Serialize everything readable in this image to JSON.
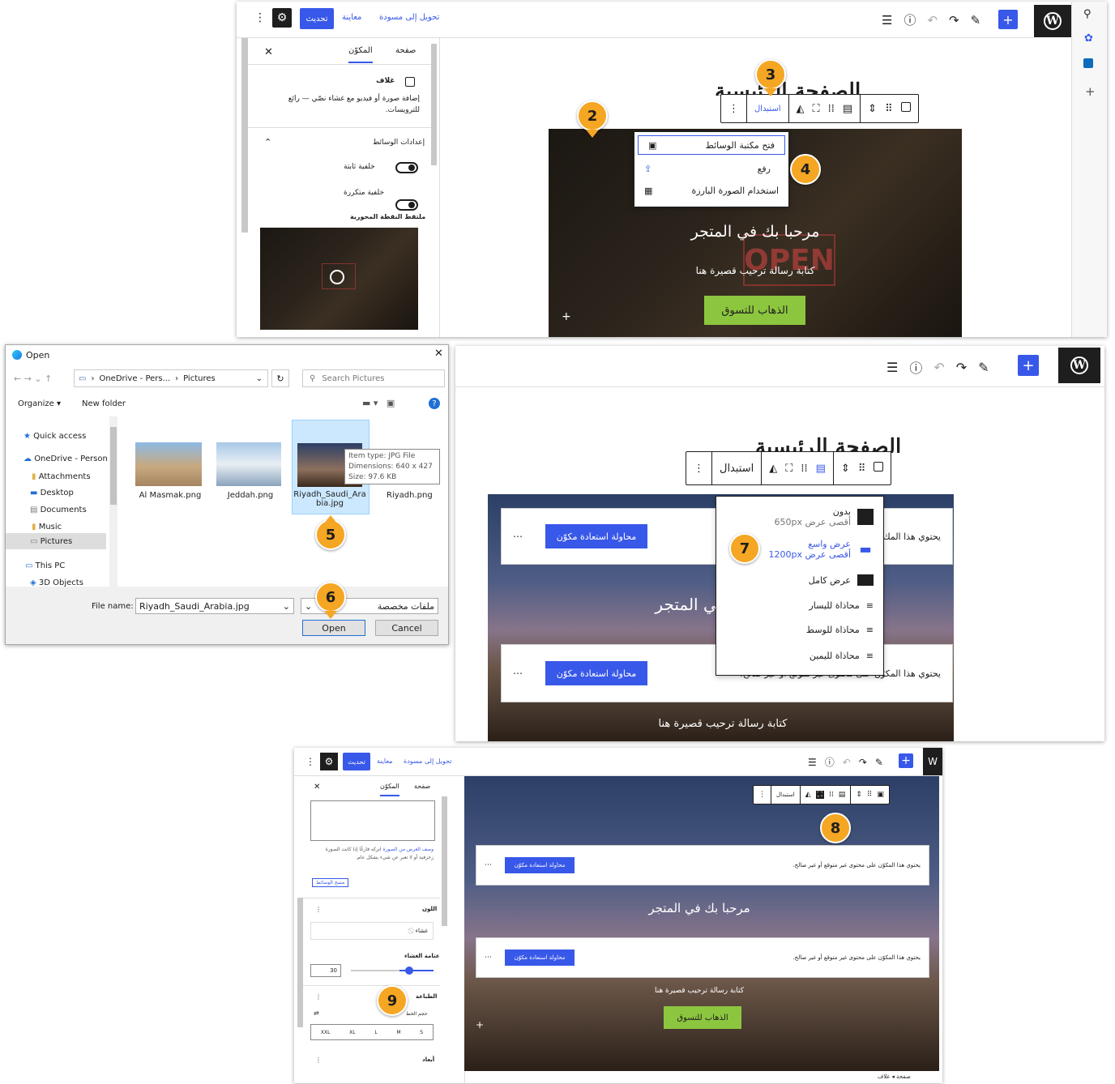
{
  "editor1": {
    "topbar": {
      "convert_draft": "تحويل إلى مسودة",
      "preview": "معاينة",
      "update": "تحديث"
    },
    "side_icons": [
      "search-icon",
      "settings-icon",
      "outlook-icon",
      "plus-icon"
    ],
    "sidebar": {
      "tab_page": "صفحة",
      "tab_block": "المكوّن",
      "block_name": "غلاف",
      "block_desc": "إضافة صورة أو فيديو مع غشاء نصّي — رائع للترويسات.",
      "media_settings": "إعدادات الوسائط",
      "fixed_bg": "خلفية ثابتة",
      "repeat_bg": "خلفية متكررة",
      "focal_point": "ملتقط النقطة المحورية"
    },
    "toolbar": {
      "replace": "استبدال"
    },
    "replace_menu": {
      "open_library": "فتح مكتبة الوسائط",
      "upload": "رفع",
      "use_featured": "استخدام الصورة البارزة"
    },
    "hero": {
      "title": "مرحبا بك في المتجر",
      "subtitle": "كتابة رسالة ترحيب قصيرة هنا",
      "button": "الذهاب للتسوق"
    },
    "page_title": "الصفحة الرئيسية"
  },
  "dialog": {
    "title": "Open",
    "path": [
      "OneDrive - Pers...",
      "Pictures"
    ],
    "search_placeholder": "Search Pictures",
    "organize": "Organize ▾",
    "new_folder": "New folder",
    "sidebar": [
      "Quick access",
      "OneDrive - Person",
      "Attachments",
      "Desktop",
      "Documents",
      "Music",
      "Pictures",
      "This PC",
      "3D Objects"
    ],
    "files": [
      "Al Masmak.png",
      "Jeddah.png",
      "Riyadh_Saudi_Arabia.jpg",
      "Riyadh.png"
    ],
    "tooltip": [
      "Item type: JPG File",
      "Dimensions: 640 x 427",
      "Size: 97.6 KB"
    ],
    "file_name_label": "File name:",
    "file_name_value": "Riyadh_Saudi_Arabia.jpg",
    "file_type": "ملفات مخصصة",
    "open": "Open",
    "cancel": "Cancel"
  },
  "editor2": {
    "toolbar": {
      "replace": "استبدال"
    },
    "notice_text": "يحتوي هذا المكوّن على محتوى غير متوقع أو غير صالح.",
    "notice_text_short": "يحتوي هذا المك",
    "recover": "محاولة استعادة مكوّن",
    "hero_title": "مرحبا بك في المتجر",
    "hero_sub": "كتابة رسالة ترحيب قصيرة هنا",
    "align_menu": [
      {
        "label": "بدون",
        "sub": "أقصى عرض 650px"
      },
      {
        "label": "عرض واسع",
        "sub": "أقصى عرض 1200px"
      },
      {
        "label": "عرض كامل",
        "sub": ""
      },
      {
        "label": "محاذاة لليسار",
        "sub": ""
      },
      {
        "label": "محاذاة للوسط",
        "sub": ""
      },
      {
        "label": "محاذاة لليمين",
        "sub": ""
      }
    ]
  },
  "editor3": {
    "topbar": {
      "convert_draft": "تحويل إلى مسودة",
      "preview": "معاينة",
      "update": "تحديث"
    },
    "tab_page": "صفحة",
    "tab_block": "المكوّن",
    "alt_help_link": "وصف الغرض من الصورة",
    "alt_help": "اتركه فارغًا إذا كانت الصورة زخرفية أو لا تعبر عن شيء بشكل عام.",
    "clear_media": "مسح الوسائط",
    "color_label": "اللون",
    "overlay": "غشاء",
    "opacity_label": "عتامة الغشاء",
    "opacity_value": "30",
    "typography": "الطباعة",
    "font_size": "حجم الخط",
    "sizes": [
      "XXL",
      "XL",
      "L",
      "M",
      "S"
    ],
    "dimensions": "أبعاد",
    "replace": "استبدال",
    "notice_text": "يحتوي هذا المكوّن على محتوى غير متوقع أو غير صالح.",
    "recover": "محاولة استعادة مكوّن",
    "hero_title": "مرحبا بك في المتجر",
    "hero_sub": "كتابة رسالة ترحيب قصيرة هنا",
    "hero_button": "الذهاب للتسوق",
    "breadcrumb": "صفحة ◂ غلاف"
  },
  "badges": [
    "2",
    "3",
    "4",
    "5",
    "6",
    "7",
    "8",
    "9"
  ],
  "colors": {
    "wp_blue": "#3858e9",
    "badge": "#f5a623",
    "cta_green": "#8cc63f",
    "dark": "#1e1e1e"
  }
}
